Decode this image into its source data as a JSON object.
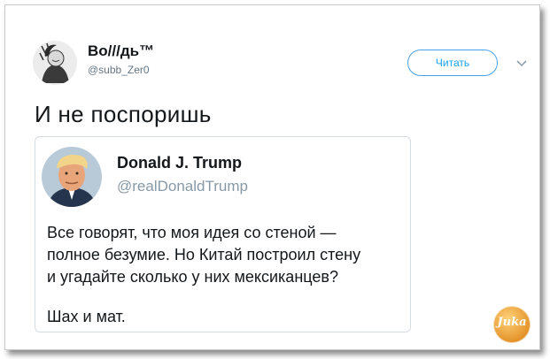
{
  "tweet": {
    "display_name": "Во///дь™",
    "handle": "@subb_Zer0",
    "follow_label": "Читать",
    "text": "И не поспоришь"
  },
  "quoted": {
    "display_name": "Donald J. Trump",
    "handle": "@realDonaldTrump",
    "body_lines": [
      "Все говорят, что моя идея со стеной —",
      "полное безумие. Но Китай построил стену",
      "и угадайте сколько у них мексиканцев?"
    ],
    "signoff": "Шах и мат."
  },
  "watermark": {
    "text": "Juka"
  },
  "colors": {
    "accent": "#1da1f2",
    "text": "#14171a",
    "muted": "#657786",
    "watermark": "#f0a23a"
  }
}
